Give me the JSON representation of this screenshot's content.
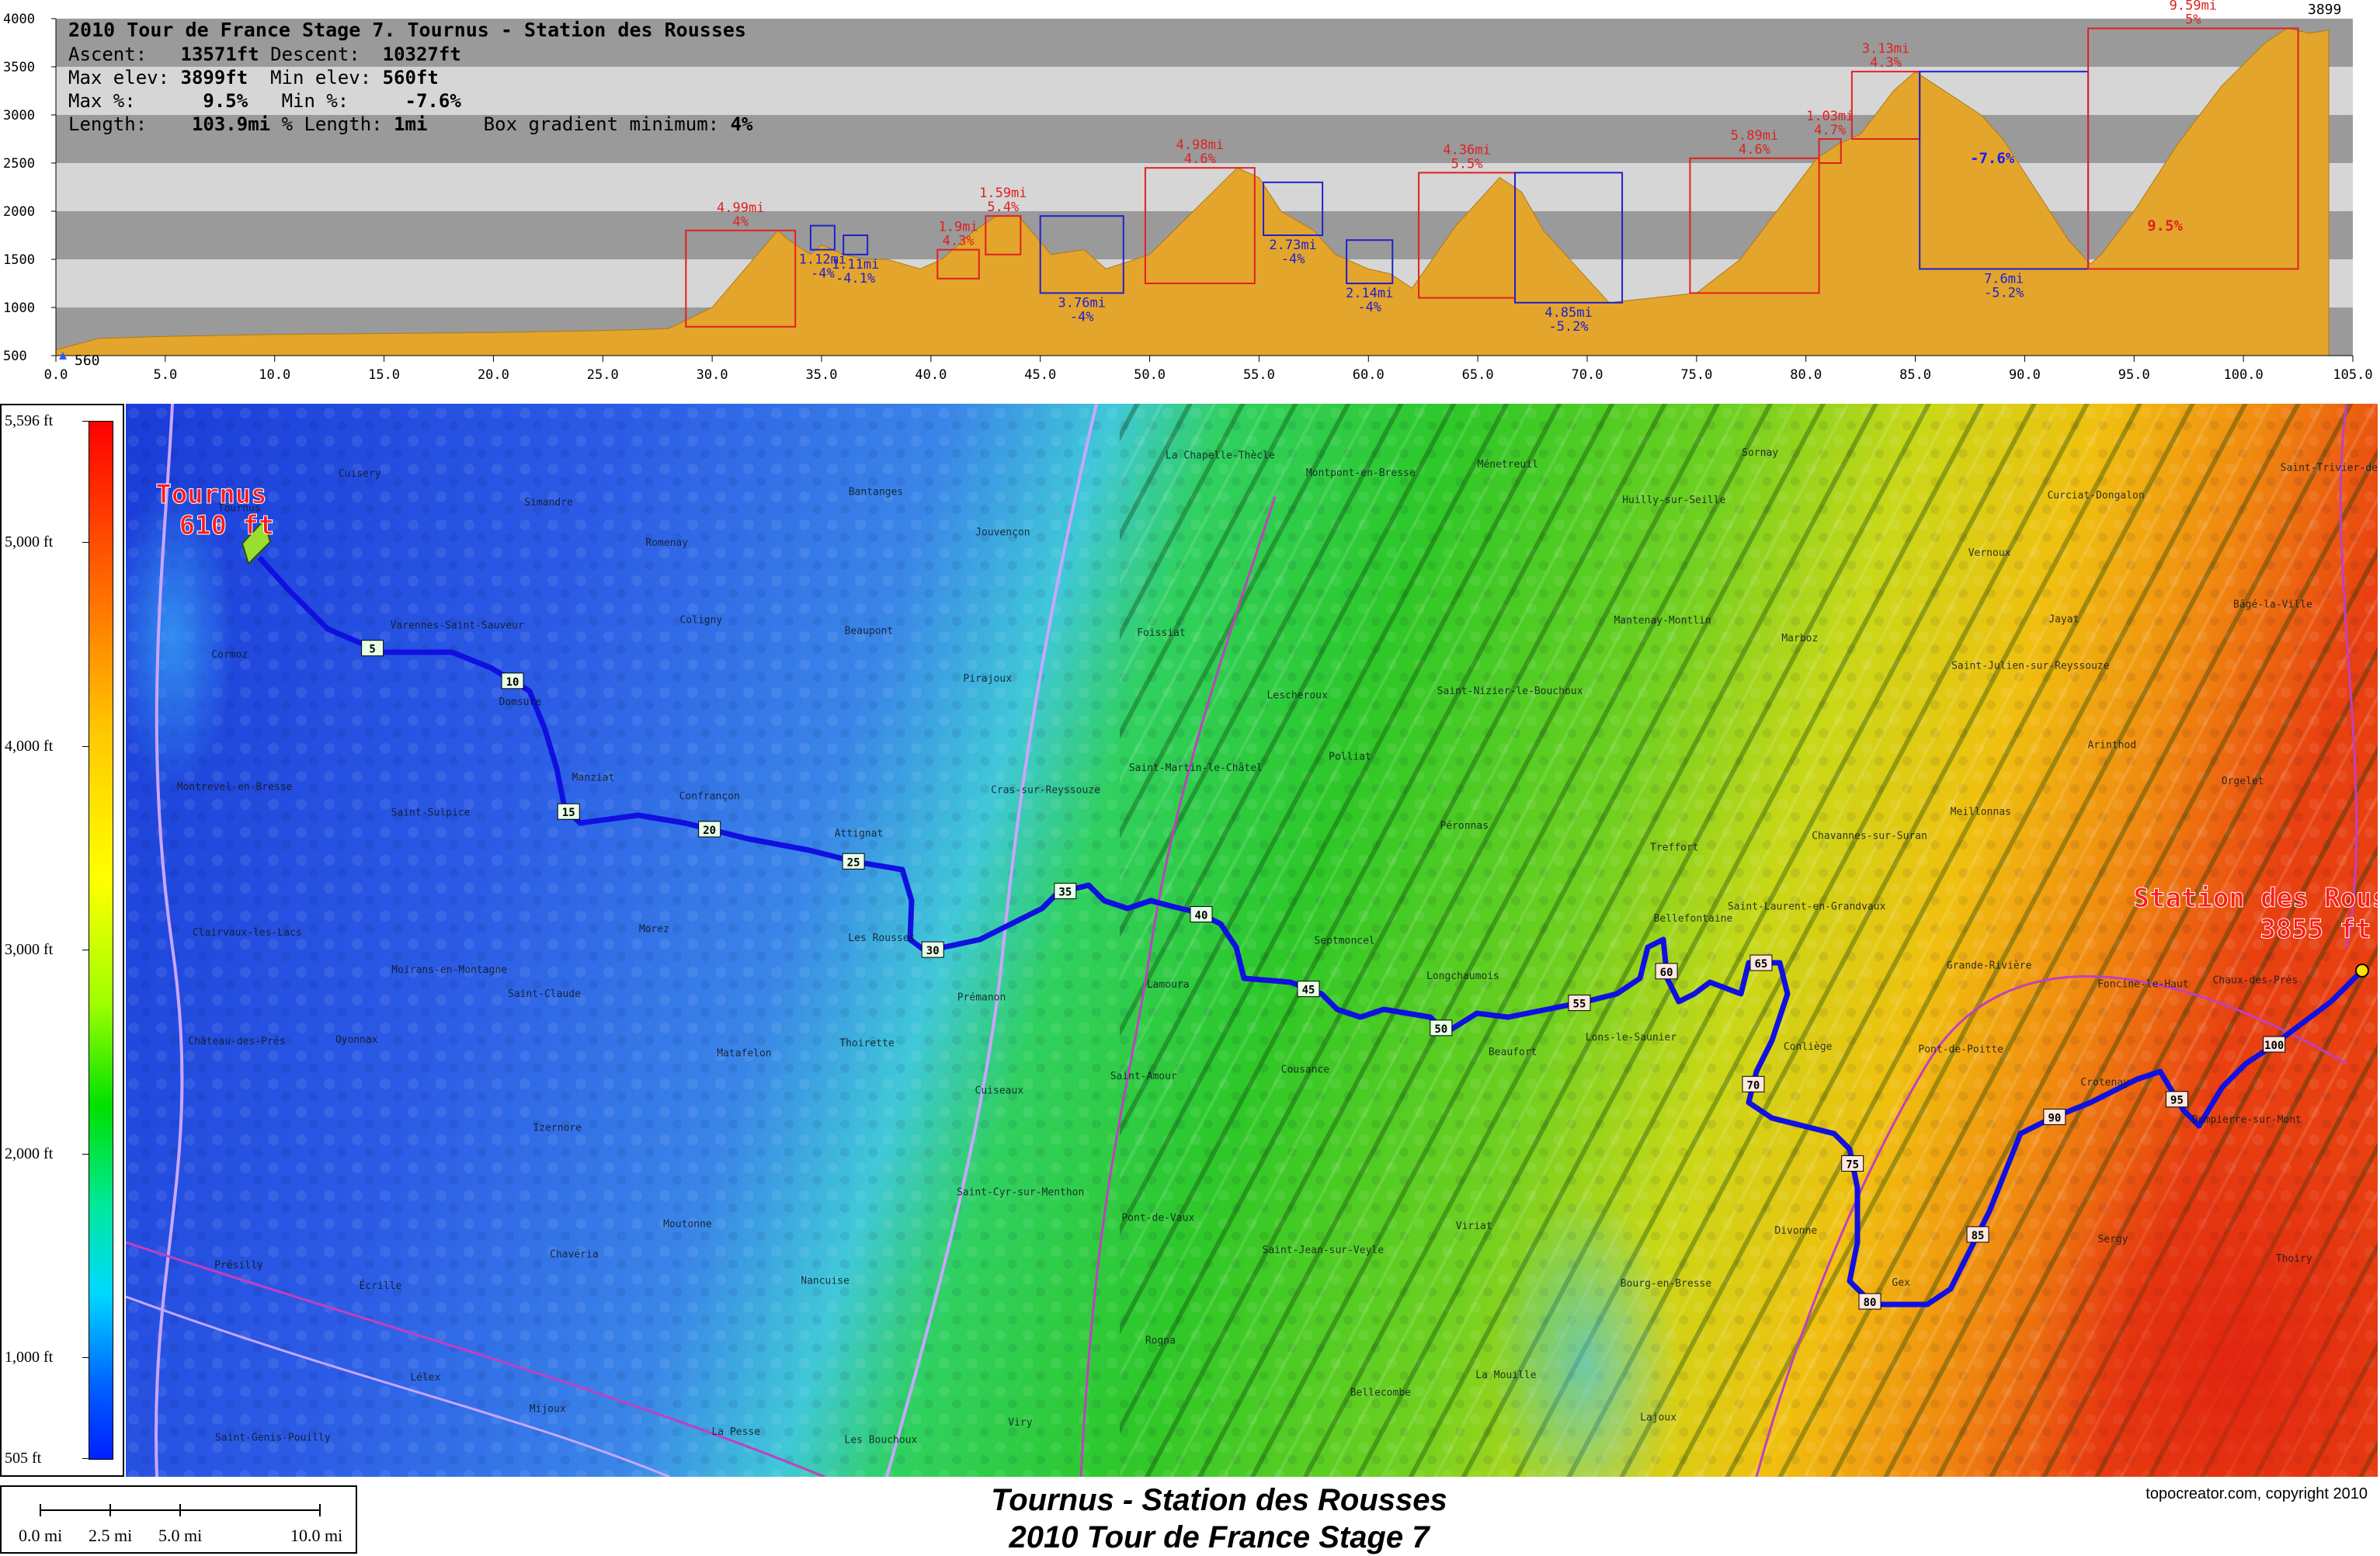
{
  "profile": {
    "title": "2010 Tour de France Stage 7. Tournus - Station des Rousses",
    "stats": {
      "ascent_label": "Ascent:",
      "ascent_value": "13571ft",
      "descent_label": "Descent:",
      "descent_value": "10327ft",
      "max_elev_label": "Max elev:",
      "max_elev_value": "3899ft",
      "min_elev_label": "Min elev:",
      "min_elev_value": "560ft",
      "max_pct_label": "Max %:",
      "max_pct_value": "9.5%",
      "min_pct_label": "Min %:",
      "min_pct_value": "-7.6%",
      "length_label": "Length:",
      "length_value": "103.9mi",
      "pct_length_label": "% Length:",
      "pct_length_value": "1mi",
      "box_min_label": "Box gradient minimum:",
      "box_min_value": "4%"
    },
    "y_ticks": [
      "4000",
      "3500",
      "3000",
      "2500",
      "2000",
      "1500",
      "1000",
      "500"
    ],
    "x_ticks": [
      "0.0",
      "5.0",
      "10.0",
      "15.0",
      "20.0",
      "25.0",
      "30.0",
      "35.0",
      "40.0",
      "45.0",
      "50.0",
      "55.0",
      "60.0",
      "65.0",
      "70.0",
      "75.0",
      "80.0",
      "85.0",
      "90.0",
      "95.0",
      "100.0",
      "105.0"
    ],
    "start_label": "560",
    "end_label": "3899",
    "elevation_points": [
      [
        0,
        560
      ],
      [
        2,
        680
      ],
      [
        5,
        700
      ],
      [
        10,
        720
      ],
      [
        15,
        730
      ],
      [
        20,
        740
      ],
      [
        25,
        760
      ],
      [
        28,
        780
      ],
      [
        30,
        1000
      ],
      [
        33,
        1800
      ],
      [
        33.5,
        1700
      ],
      [
        34.5,
        1550
      ],
      [
        35,
        1650
      ],
      [
        36,
        1550
      ],
      [
        37,
        1500
      ],
      [
        38,
        1500
      ],
      [
        39.5,
        1400
      ],
      [
        40.5,
        1500
      ],
      [
        42,
        1800
      ],
      [
        43,
        1950
      ],
      [
        44,
        1950
      ],
      [
        45.5,
        1550
      ],
      [
        47,
        1600
      ],
      [
        48,
        1400
      ],
      [
        50,
        1550
      ],
      [
        52,
        2000
      ],
      [
        54,
        2450
      ],
      [
        55,
        2350
      ],
      [
        56,
        2000
      ],
      [
        57.5,
        1800
      ],
      [
        58.5,
        1550
      ],
      [
        60,
        1400
      ],
      [
        61,
        1350
      ],
      [
        62,
        1200
      ],
      [
        64,
        1850
      ],
      [
        66,
        2350
      ],
      [
        67,
        2200
      ],
      [
        68,
        1800
      ],
      [
        70,
        1300
      ],
      [
        71,
        1050
      ],
      [
        73,
        1100
      ],
      [
        75,
        1150
      ],
      [
        77,
        1500
      ],
      [
        79,
        2100
      ],
      [
        80.5,
        2550
      ],
      [
        81.5,
        2700
      ],
      [
        82.5,
        2800
      ],
      [
        84,
        3250
      ],
      [
        85,
        3450
      ],
      [
        86,
        3300
      ],
      [
        88,
        3000
      ],
      [
        89,
        2750
      ],
      [
        90,
        2400
      ],
      [
        91,
        2050
      ],
      [
        92,
        1700
      ],
      [
        93,
        1450
      ],
      [
        93.5,
        1550
      ],
      [
        95,
        2000
      ],
      [
        97,
        2700
      ],
      [
        99,
        3300
      ],
      [
        101,
        3750
      ],
      [
        102,
        3899
      ],
      [
        103,
        3850
      ],
      [
        103.9,
        3880
      ]
    ],
    "climb_boxes": [
      {
        "x0": 28.8,
        "x1": 33.8,
        "y0": 800,
        "y1": 1800,
        "type": "climb",
        "dist": "4.99mi",
        "pct": "4%"
      },
      {
        "x0": 34.5,
        "x1": 35.6,
        "y0": 1600,
        "y1": 1850,
        "type": "descent",
        "dist": "1.12mi",
        "pct": "-4%"
      },
      {
        "x0": 36.0,
        "x1": 37.1,
        "y0": 1550,
        "y1": 1750,
        "type": "descent",
        "dist": "1.11mi",
        "pct": "-4.1%"
      },
      {
        "x0": 40.3,
        "x1": 42.2,
        "y0": 1300,
        "y1": 1600,
        "type": "climb",
        "dist": "1.9mi",
        "pct": "4.3%"
      },
      {
        "x0": 42.5,
        "x1": 44.1,
        "y0": 1550,
        "y1": 1950,
        "type": "climb",
        "dist": "1.59mi",
        "pct": "5.4%"
      },
      {
        "x0": 45.0,
        "x1": 48.8,
        "y0": 1150,
        "y1": 1950,
        "type": "descent",
        "dist": "3.76mi",
        "pct": "-4%"
      },
      {
        "x0": 49.8,
        "x1": 54.8,
        "y0": 1250,
        "y1": 2450,
        "type": "climb",
        "dist": "4.98mi",
        "pct": "4.6%"
      },
      {
        "x0": 55.2,
        "x1": 57.9,
        "y0": 1750,
        "y1": 2300,
        "type": "descent",
        "dist": "2.73mi",
        "pct": "-4%"
      },
      {
        "x0": 59.0,
        "x1": 61.1,
        "y0": 1250,
        "y1": 1700,
        "type": "descent",
        "dist": "2.14mi",
        "pct": "-4%"
      },
      {
        "x0": 62.3,
        "x1": 66.7,
        "y0": 1100,
        "y1": 2400,
        "type": "climb",
        "dist": "4.36mi",
        "pct": "5.5%"
      },
      {
        "x0": 66.7,
        "x1": 71.6,
        "y0": 1050,
        "y1": 2400,
        "type": "descent",
        "dist": "4.85mi",
        "pct": "-5.2%"
      },
      {
        "x0": 74.7,
        "x1": 80.6,
        "y0": 1150,
        "y1": 2550,
        "type": "climb",
        "dist": "5.89mi",
        "pct": "4.6%"
      },
      {
        "x0": 80.6,
        "x1": 81.6,
        "y0": 2500,
        "y1": 2750,
        "type": "climb",
        "dist": "1.03mi",
        "pct": "4.7%"
      },
      {
        "x0": 82.1,
        "x1": 85.2,
        "y0": 2750,
        "y1": 3450,
        "type": "climb",
        "dist": "3.13mi",
        "pct": "4.3%"
      },
      {
        "x0": 85.2,
        "x1": 92.9,
        "y0": 1400,
        "y1": 3450,
        "type": "descent",
        "dist": "7.6mi",
        "pct": "-5.2%"
      },
      {
        "x0": 92.9,
        "x1": 102.5,
        "y0": 1400,
        "y1": 3899,
        "type": "climb",
        "dist": "9.59mi",
        "pct": "5%"
      }
    ],
    "inline_labels": [
      {
        "text": "-7.6%",
        "x": 87.5,
        "y": 2500,
        "color": "#1a1aff"
      },
      {
        "text": "9.5%",
        "x": 95.6,
        "y": 1800,
        "color": "#e02020"
      }
    ]
  },
  "legend": {
    "ticks": [
      "5,596 ft",
      "5,000 ft",
      "4,000 ft",
      "3,000 ft",
      "2,000 ft",
      "1,000 ft",
      "505 ft"
    ],
    "min_ft": 505,
    "max_ft": 5596,
    "tick_values": [
      5596,
      5000,
      4000,
      3000,
      2000,
      1000,
      505
    ]
  },
  "scale_bar": {
    "labels": [
      "0.0 mi",
      "2.5 mi",
      "5.0 mi",
      "10.0 mi"
    ]
  },
  "map": {
    "start_label": {
      "name": "Tournus",
      "elev": "610 ft"
    },
    "finish_label": {
      "name": "Station des Rousses",
      "elev": "3855 ft"
    },
    "mile_markers": [
      "5",
      "10",
      "15",
      "20",
      "25",
      "30",
      "35",
      "40",
      "45",
      "50",
      "55",
      "60",
      "65",
      "70",
      "75",
      "80",
      "85",
      "90",
      "95",
      "100"
    ],
    "place_names": [
      "Tournus",
      "Cuisery",
      "Simandre",
      "Romenay",
      "Bantanges",
      "Jouvençon",
      "La Chapelle-Thècle",
      "Montpont-en-Bresse",
      "Ménetreuil",
      "Huilly-sur-Seille",
      "Sornay",
      "Vernoux",
      "Curciat-Dongalon",
      "Saint-Trivier-de-Courtes",
      "Cormoz",
      "Varennes-Saint-Sauveur",
      "Domsure",
      "Coligny",
      "Beaupont",
      "Pirajoux",
      "Foissiat",
      "Lescheroux",
      "Saint-Nizier-le-Bouchoux",
      "Mantenay-Montlin",
      "Marboz",
      "Saint-Julien-sur-Reyssouze",
      "Jayat",
      "Bâgé-la-Ville",
      "Montrevel-en-Bresse",
      "Saint-Sulpice",
      "Manziat",
      "Confrançon",
      "Attignat",
      "Cras-sur-Reyssouze",
      "Saint-Martin-le-Châtel",
      "Polliat",
      "Péronnas",
      "Treffort",
      "Chavannes-sur-Suran",
      "Meillonnas",
      "Arinthod",
      "Orgelet",
      "Clairvaux-les-Lacs",
      "Moirans-en-Montagne",
      "Saint-Claude",
      "Morez",
      "Les Rousses",
      "Prémanon",
      "Lamoura",
      "Septmoncel",
      "Longchaumois",
      "Bellefontaine",
      "Saint-Laurent-en-Grandvaux",
      "Grande-Rivière",
      "Foncine-le-Haut",
      "Chaux-des-Prés",
      "Château-des-Prés",
      "Oyonnax",
      "Izernore",
      "Matafelon",
      "Thoirette",
      "Cuiseaux",
      "Saint-Amour",
      "Cousance",
      "Beaufort",
      "Lons-le-Saunier",
      "Conliège",
      "Pont-de-Poitte",
      "Crotenay",
      "Dompierre-sur-Mont",
      "Présilly",
      "Écrille",
      "Chavéria",
      "Moutonne",
      "Nancuise",
      "Saint-Cyr-sur-Menthon",
      "Pont-de-Vaux",
      "Saint-Jean-sur-Veyle",
      "Viriat",
      "Bourg-en-Bresse",
      "Divonne",
      "Gex",
      "Sergy",
      "Thoiry",
      "Saint-Genis-Pouilly",
      "Lélex",
      "Mijoux",
      "La Pesse",
      "Les Bouchoux",
      "Viry",
      "Rogna",
      "Bellecombe",
      "La Mouille",
      "Lajoux"
    ]
  },
  "footer": {
    "title_line1": "Tournus - Station des Rousses",
    "title_line2": "2010 Tour de France Stage 7",
    "copyright": "topocreator.com, copyright 2010"
  },
  "colors": {
    "profile_fill": "#e3a52b",
    "band_dark": "#9a9a9a",
    "band_light": "#d6d6d6",
    "climb_box": "#e02020",
    "descent_box": "#2020d0",
    "route": "#1010e0",
    "label_red": "#ff1a1a"
  }
}
